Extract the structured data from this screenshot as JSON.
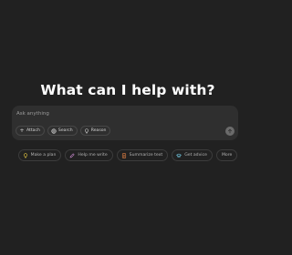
{
  "headline": "What can I help with?",
  "composer": {
    "placeholder": "Ask anything",
    "buttons": [
      {
        "label": "Attach",
        "icon": "plus-icon"
      },
      {
        "label": "Search",
        "icon": "globe-icon"
      },
      {
        "label": "Reason",
        "icon": "lightbulb-icon"
      }
    ],
    "send_icon": "arrow-up-icon"
  },
  "suggestions": [
    {
      "label": "Make a plan",
      "icon": "lightbulb-icon",
      "color": "#e2c541"
    },
    {
      "label": "Help me write",
      "icon": "pen-icon",
      "color": "#cb8bd0"
    },
    {
      "label": "Summarize text",
      "icon": "document-icon",
      "color": "#ea8444"
    },
    {
      "label": "Get advice",
      "icon": "graduation-cap-icon",
      "color": "#76d0eb"
    },
    {
      "label": "More",
      "icon": ""
    }
  ],
  "colors": {
    "background": "#212121",
    "composer": "#2f2f2f",
    "text": "#ffffff"
  }
}
